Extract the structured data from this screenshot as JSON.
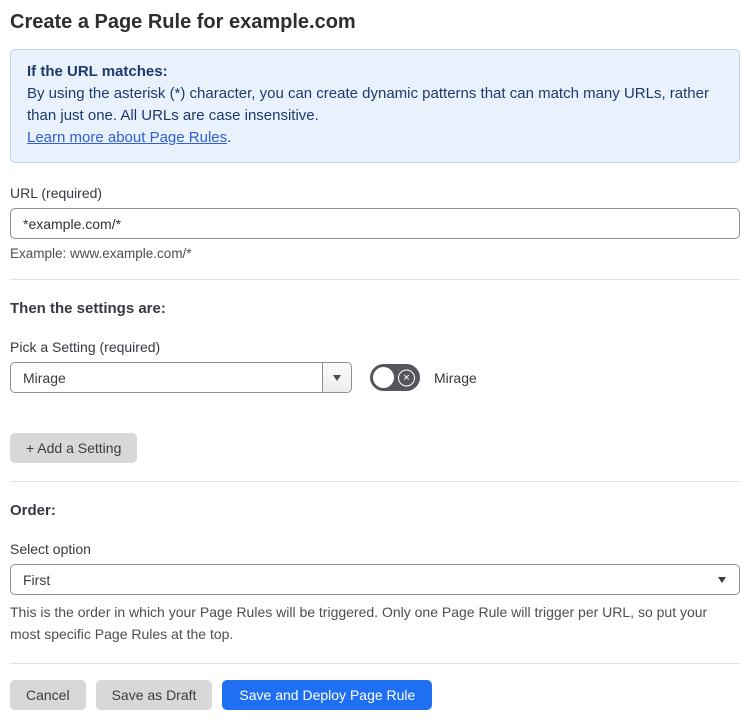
{
  "page": {
    "title": "Create a Page Rule for example.com"
  },
  "info_box": {
    "heading": "If the URL matches:",
    "body": "By using the asterisk (*) character, you can create dynamic patterns that can match many URLs, rather than just one. All URLs are case insensitive.",
    "link_label": "Learn more about Page Rules",
    "link_suffix": "."
  },
  "url_field": {
    "label": "URL (required)",
    "value": "*example.com/*",
    "helper": "Example: www.example.com/*"
  },
  "settings_section": {
    "heading": "Then the settings are:",
    "picker_label": "Pick a Setting (required)",
    "selected_setting": "Mirage",
    "toggle": {
      "label": "Mirage",
      "state": "off",
      "off_glyph": "✕"
    },
    "add_setting_label": "+ Add a Setting"
  },
  "order_section": {
    "heading": "Order:",
    "select_label": "Select option",
    "selected_option": "First",
    "helper": "This is the order in which your Page Rules will be triggered. Only one Page Rule will trigger per URL, so put your most specific Page Rules at the top."
  },
  "footer": {
    "cancel_label": "Cancel",
    "save_draft_label": "Save as Draft",
    "save_deploy_label": "Save and Deploy Page Rule"
  },
  "icons": {
    "select_arrow": "chevron-down-icon",
    "toggle_off": "x-circle-icon"
  },
  "colors": {
    "info_bg": "#e8f1fc",
    "info_border": "#b9d3f1",
    "info_text": "#1d3a6e",
    "link_blue": "#3060d4",
    "primary_blue": "#1f6ff2",
    "toggle_off_gray": "#54565b",
    "button_gray": "#d8d8d8",
    "divider_gray": "#e2e2e2"
  }
}
